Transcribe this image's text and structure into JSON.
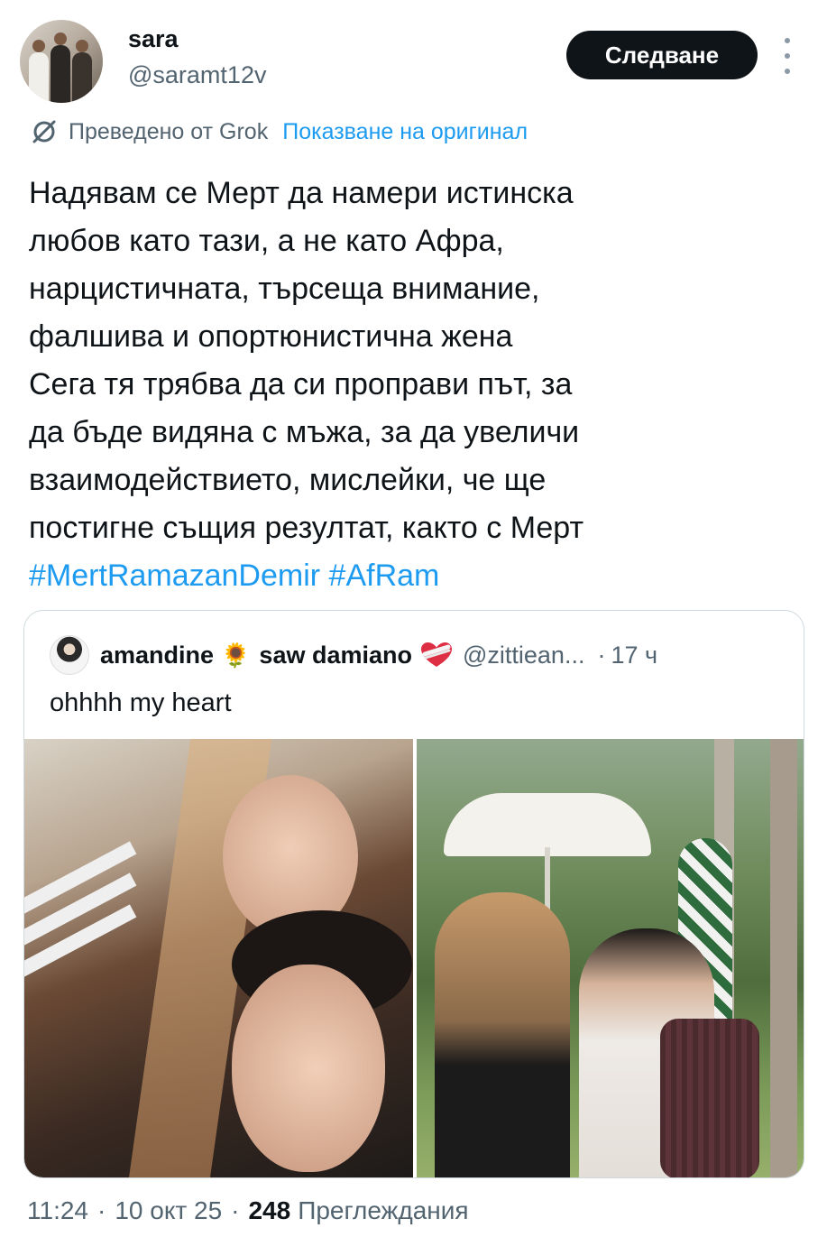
{
  "author": {
    "name": "sara",
    "handle": "@saramt12v"
  },
  "follow_label": "Следване",
  "translation": {
    "label": "Преведено от Grok",
    "show_original": "Показване на оригинал"
  },
  "tweet": {
    "lines": [
      "Надявам се Мерт да намери истинска",
      "любов като тази, а не като Афра,",
      "нарцистичната, търсеща внимание,",
      "фалшива и опортюнистична жена",
      "Сега тя трябва да си проправи път, за",
      "да бъде видяна с мъжа, за да увеличи",
      "взаимодействието, мислейки, че ще",
      "постигне същия резултат, както с Мерт"
    ],
    "hashtags": "#MertRamazanDemir #AfRam"
  },
  "quote": {
    "name": "amandine",
    "name_emoji": "🌻",
    "name2": "saw damiano",
    "handle": "@zittiean...",
    "dot": "·",
    "time": "17 ч",
    "text": "ohhhh my heart"
  },
  "meta": {
    "time": "11:24",
    "date": "10 окт 25",
    "views_count": "248",
    "views_label": "Преглеждания",
    "separator": "·"
  },
  "colors": {
    "link": "#1d9bf0",
    "muted": "#536471",
    "text": "#0f1419",
    "button_bg": "#0f1419"
  }
}
